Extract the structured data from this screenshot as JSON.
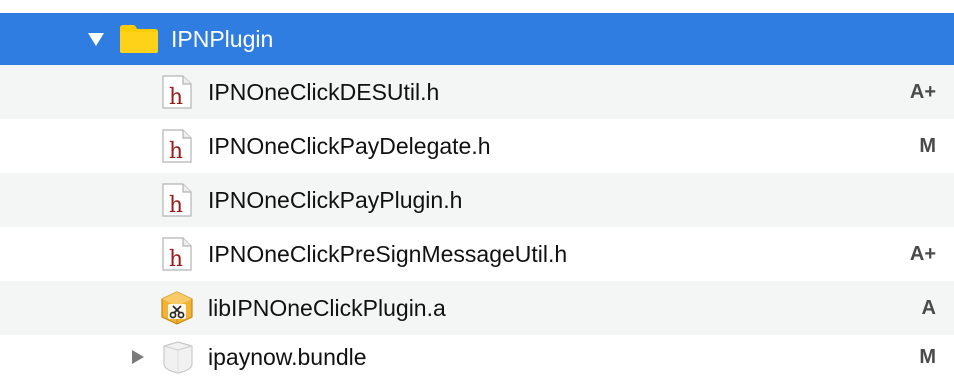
{
  "tree": {
    "folder": {
      "name": "IPNPlugin",
      "icon": "folder-icon",
      "expanded": true,
      "disclosure_icon": "disclosure-triangle-down-icon"
    },
    "items": [
      {
        "name": "IPNOneClickDESUtil.h",
        "icon": "header-file-icon",
        "icon_glyph": "h",
        "status": "A+"
      },
      {
        "name": "IPNOneClickPayDelegate.h",
        "icon": "header-file-icon",
        "icon_glyph": "h",
        "status": "M"
      },
      {
        "name": "IPNOneClickPayPlugin.h",
        "icon": "header-file-icon",
        "icon_glyph": "h",
        "status": ""
      },
      {
        "name": "IPNOneClickPreSignMessageUtil.h",
        "icon": "header-file-icon",
        "icon_glyph": "h",
        "status": "A+"
      },
      {
        "name": "libIPNOneClickPlugin.a",
        "icon": "static-library-icon",
        "status": "A"
      },
      {
        "name": "ipaynow.bundle",
        "icon": "bundle-icon",
        "disclosure_icon": "disclosure-triangle-right-icon",
        "status": "M"
      }
    ]
  },
  "colors": {
    "selection": "#2f7de1",
    "folder": "#ffcd00",
    "header_glyph": "#9b1b1b",
    "status": "#4a4a4a"
  }
}
